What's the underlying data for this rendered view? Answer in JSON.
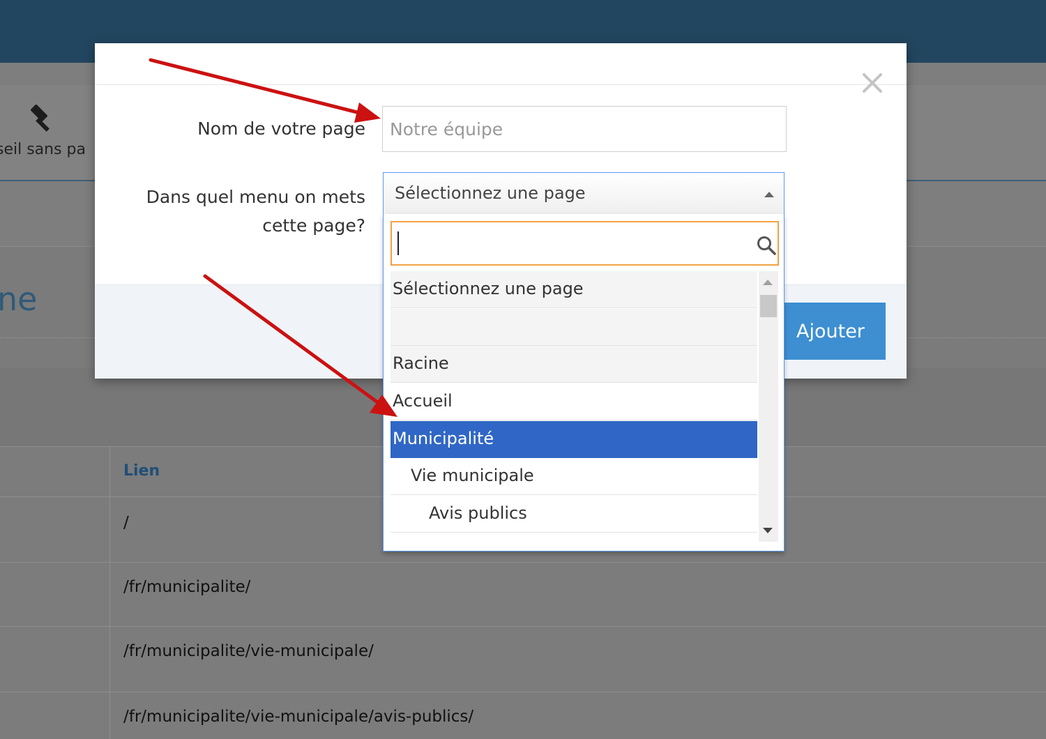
{
  "background": {
    "toolbar_item_label": "seil sans pa",
    "heading_fragment": "ne",
    "table": {
      "column_header": "Lien",
      "rows": [
        "/",
        "/fr/municipalite/",
        "/fr/municipalite/vie-municipale/",
        "/fr/municipalite/vie-municipale/avis-publics/"
      ]
    }
  },
  "modal": {
    "name_label": "Nom de votre page",
    "name_placeholder": "Notre équipe",
    "menu_label_line1": "Dans quel menu on mets",
    "menu_label_line2": "cette page?",
    "select_value": "Sélectionnez une page",
    "search_value": "",
    "options": [
      {
        "label": "Sélectionnez une page",
        "level": 0
      },
      {
        "label": "",
        "level": 0
      },
      {
        "label": "Racine",
        "level": 0
      },
      {
        "label": "Accueil",
        "level": 0
      },
      {
        "label": "Municipalité",
        "level": 0
      },
      {
        "label": "Vie municipale",
        "level": 1
      },
      {
        "label": "Avis publics",
        "level": 2
      }
    ],
    "highlighted_option": "Municipalité",
    "add_button_label": "Ajouter"
  },
  "colors": {
    "topbar": "#22465f",
    "highlight": "#3067c6",
    "add_button": "#3d8fd1",
    "search_border": "#f0a243",
    "arrow": "#cc1111"
  }
}
